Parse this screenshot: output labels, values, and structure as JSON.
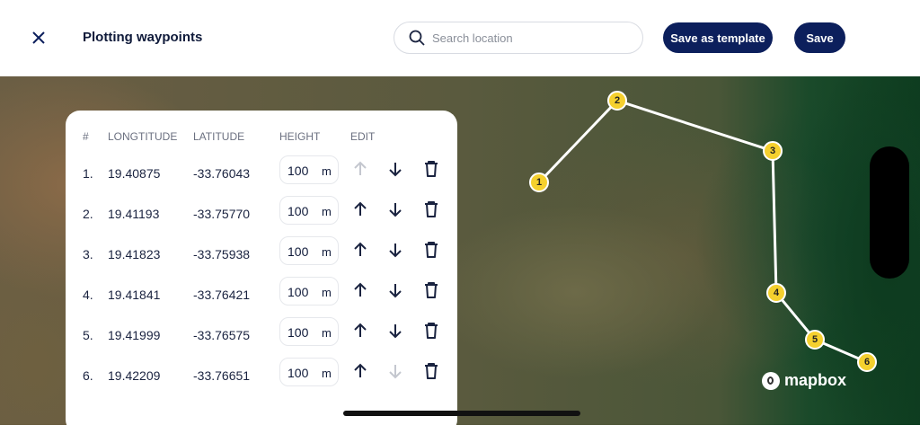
{
  "header": {
    "title": "Plotting waypoints",
    "search_placeholder": "Search location",
    "save_template_label": "Save as template",
    "save_label": "Save"
  },
  "table": {
    "columns": [
      "#",
      "LONGTITUDE",
      "LATITUDE",
      "HEIGHT",
      "EDIT"
    ],
    "rows": [
      {
        "index": "1.",
        "lon": "19.40875",
        "lat": "-33.76043",
        "height": "100",
        "unit": "m",
        "up_enabled": false,
        "down_enabled": true
      },
      {
        "index": "2.",
        "lon": "19.41193",
        "lat": "-33.75770",
        "height": "100",
        "unit": "m",
        "up_enabled": true,
        "down_enabled": true
      },
      {
        "index": "3.",
        "lon": "19.41823",
        "lat": "-33.75938",
        "height": "100",
        "unit": "m",
        "up_enabled": true,
        "down_enabled": true
      },
      {
        "index": "4.",
        "lon": "19.41841",
        "lat": "-33.76421",
        "height": "100",
        "unit": "m",
        "up_enabled": true,
        "down_enabled": true
      },
      {
        "index": "5.",
        "lon": "19.41999",
        "lat": "-33.76575",
        "height": "100",
        "unit": "m",
        "up_enabled": true,
        "down_enabled": true
      },
      {
        "index": "6.",
        "lon": "19.42209",
        "lat": "-33.76651",
        "height": "100",
        "unit": "m",
        "up_enabled": true,
        "down_enabled": false
      }
    ]
  },
  "map": {
    "markers": [
      "1",
      "2",
      "3",
      "4",
      "5",
      "6"
    ],
    "attribution": "mapbox",
    "marker_color": "#f5d02e"
  },
  "colors": {
    "primary": "#0c1f5c"
  }
}
